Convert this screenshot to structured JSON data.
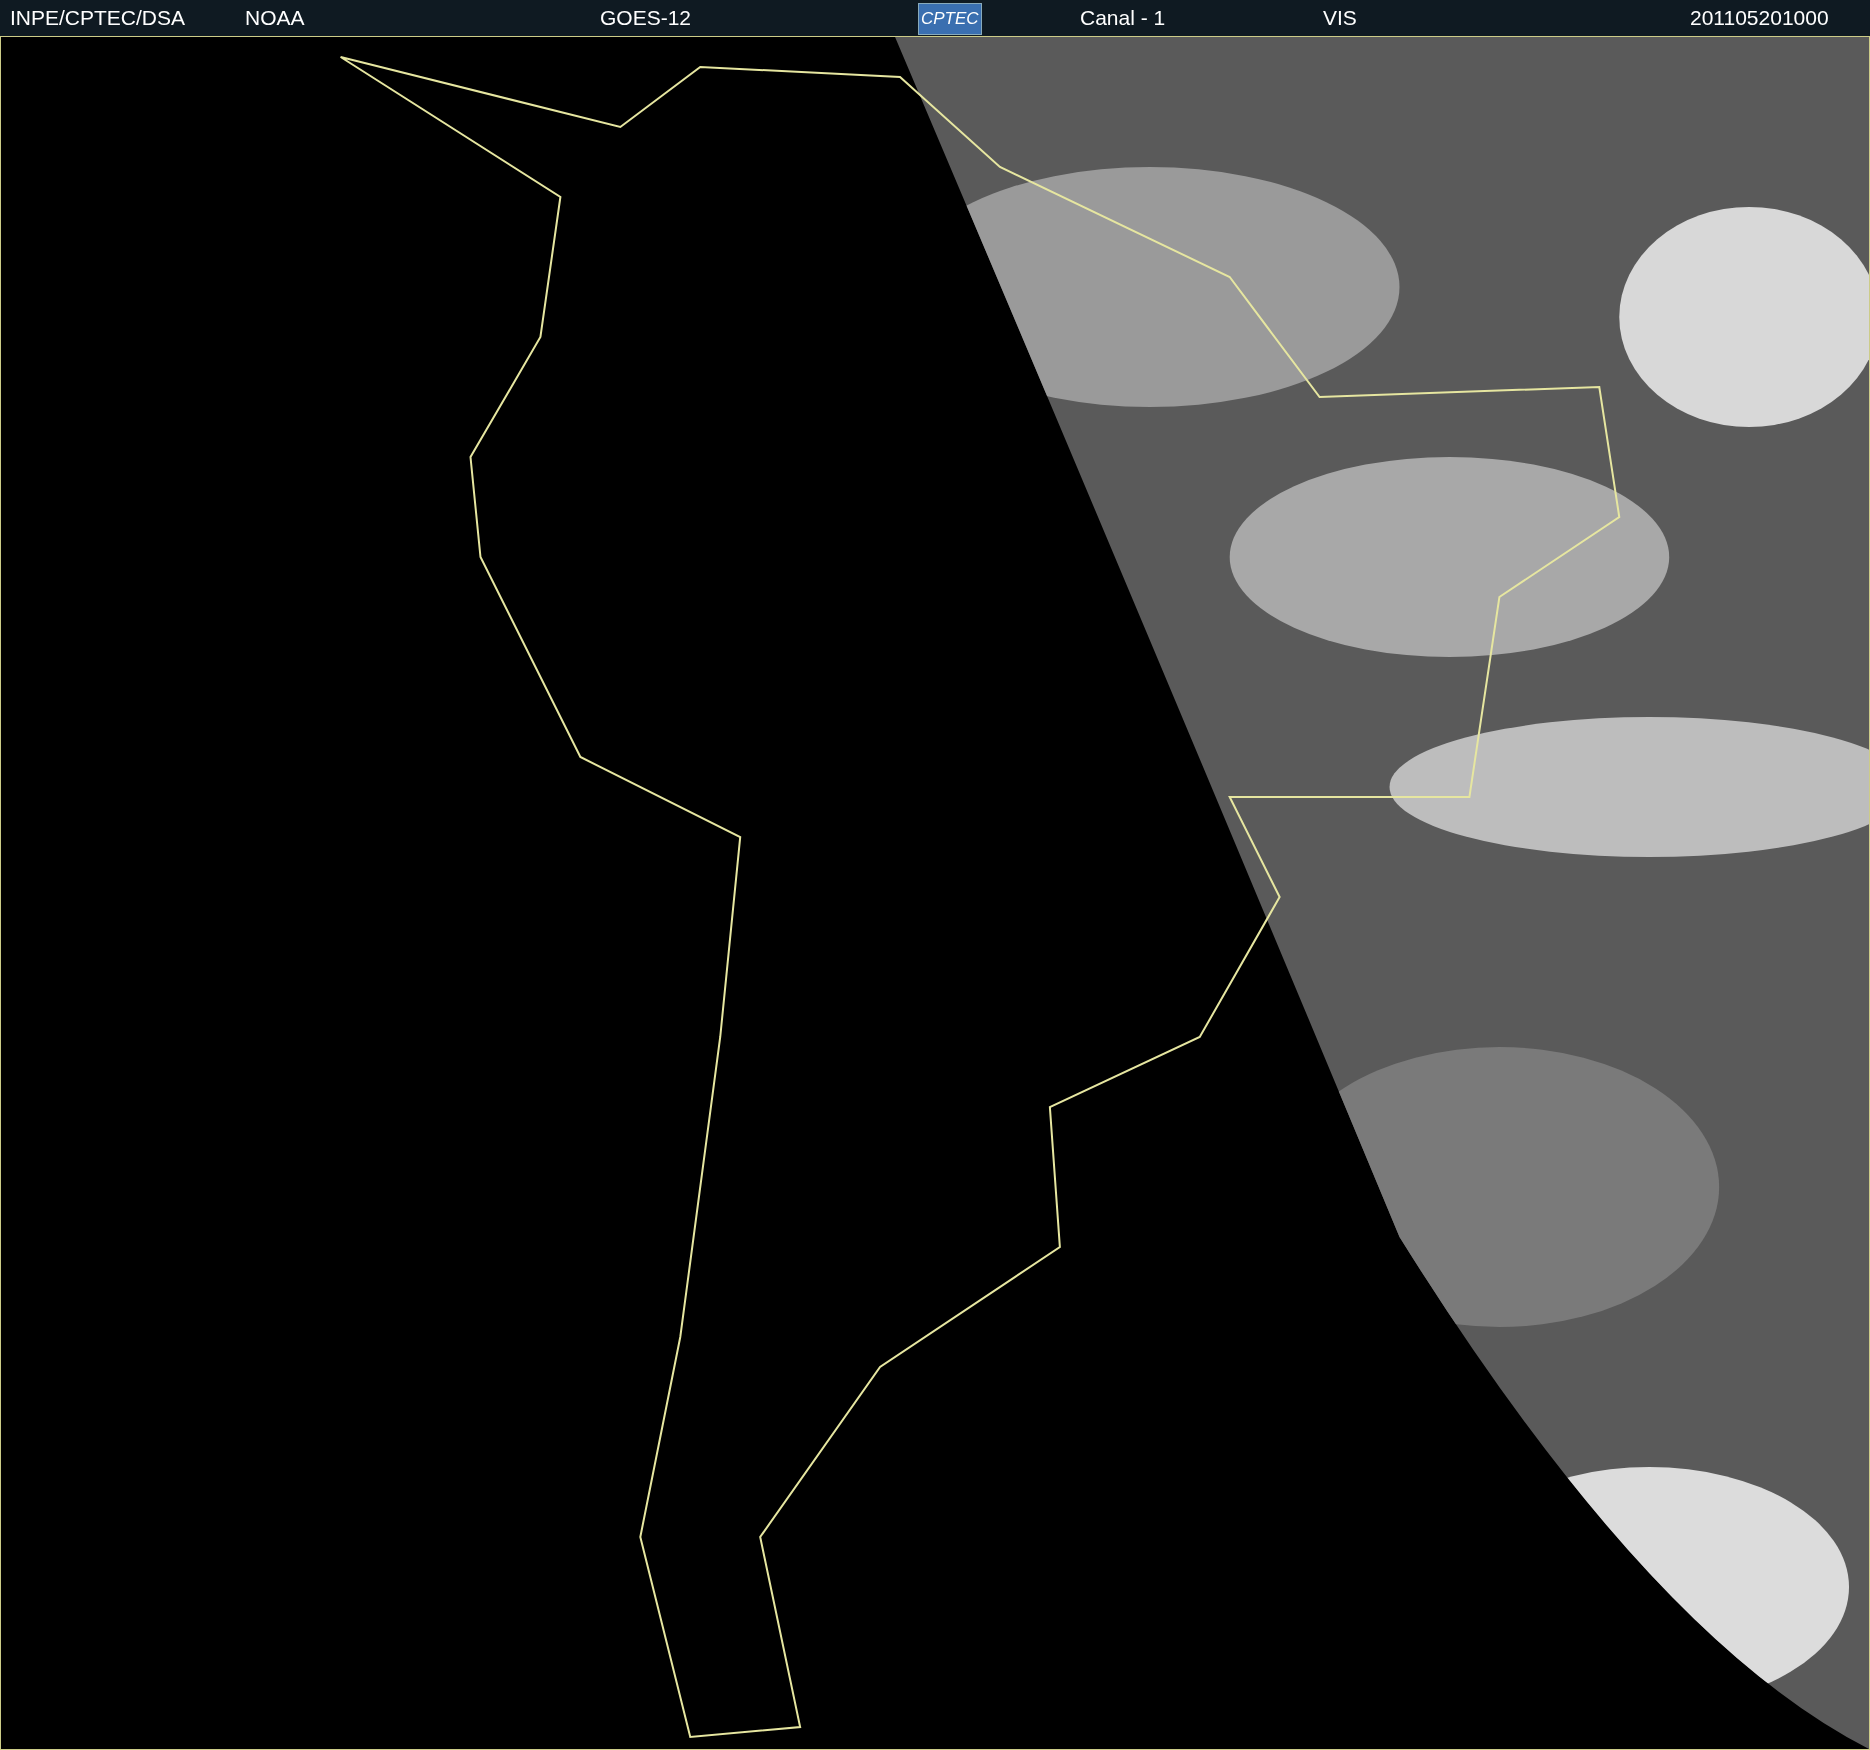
{
  "header": {
    "source": "INPE/CPTEC/DSA",
    "agency": "NOAA",
    "satellite": "GOES-12",
    "logo": "CPTEC",
    "channel": "Canal - 1",
    "band": "VIS",
    "timestamp": "201105201000"
  }
}
